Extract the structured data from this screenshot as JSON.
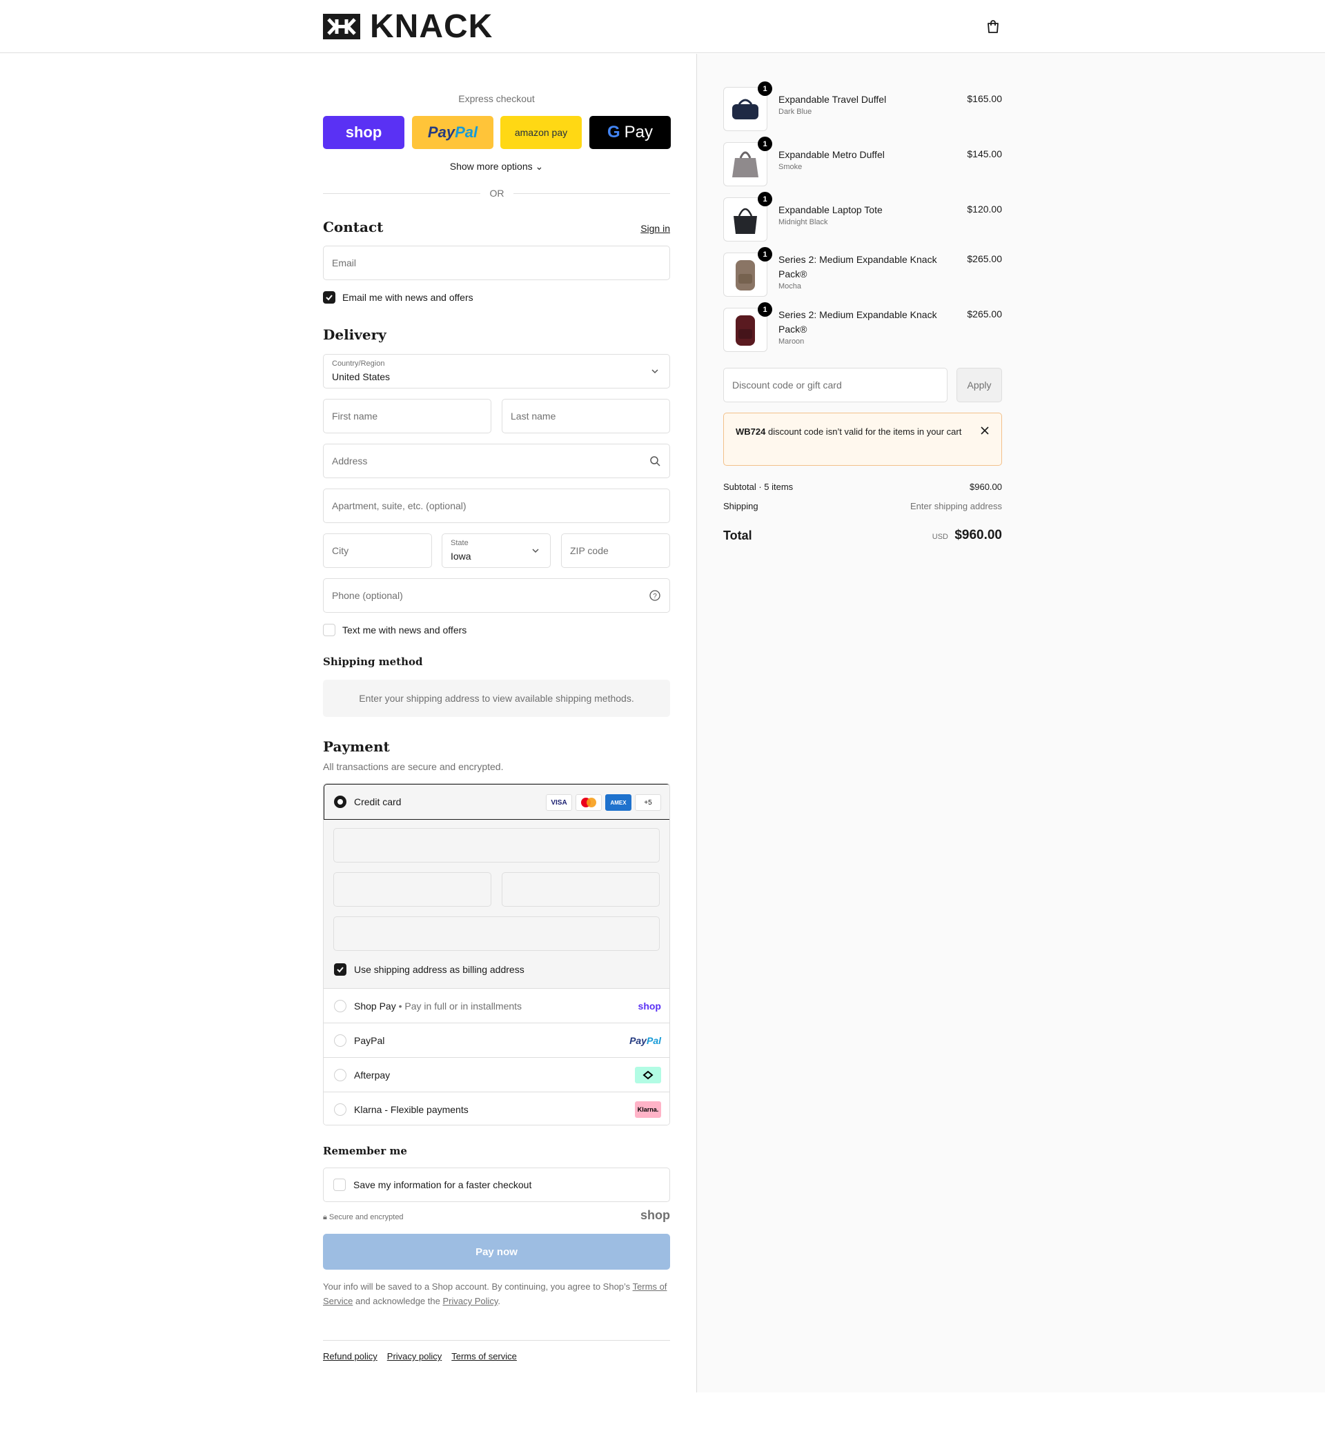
{
  "brand": {
    "name": "KNACK"
  },
  "express": {
    "title": "Express checkout",
    "shop_label": "shop",
    "paypal_label_1": "Pay",
    "paypal_label_2": "Pal",
    "amazon_label": "amazon pay",
    "gpay_label": "Pay",
    "show_more": "Show more options",
    "or": "OR"
  },
  "contact": {
    "heading": "Contact",
    "sign_in": "Sign in",
    "email_placeholder": "Email",
    "news_label": "Email me with news and offers"
  },
  "delivery": {
    "heading": "Delivery",
    "country_label": "Country/Region",
    "country_value": "United States",
    "first_name": "First name",
    "last_name": "Last name",
    "address": "Address",
    "apartment": "Apartment, suite, etc. (optional)",
    "city": "City",
    "state_label": "State",
    "state_value": "Iowa",
    "zip": "ZIP code",
    "phone": "Phone (optional)",
    "text_label": "Text me with news and offers"
  },
  "shipping": {
    "heading": "Shipping method",
    "message": "Enter your shipping address to view available shipping methods."
  },
  "payment": {
    "heading": "Payment",
    "subtitle": "All transactions are secure and encrypted.",
    "credit_card": "Credit card",
    "card_visa": "VISA",
    "card_more": "+5",
    "billing_label": "Use shipping address as billing address",
    "shop_pay": "Shop Pay",
    "shop_pay_sub": "Pay in full or in installments",
    "shop_pay_logo": "shop",
    "paypal": "PayPal",
    "afterpay": "Afterpay",
    "klarna": "Klarna - Flexible payments",
    "klarna_logo": "Klarna."
  },
  "remember": {
    "heading": "Remember me",
    "save_label": "Save my information for a faster checkout",
    "secure": "Secure and encrypted",
    "shop_logo": "shop"
  },
  "pay_now": "Pay now",
  "legal": {
    "text_1": "Your info will be saved to a Shop account. By continuing, you agree to Shop’s ",
    "terms": "Terms of Service",
    "text_2": " and acknowledge the ",
    "privacy": "Privacy Policy",
    "text_3": "."
  },
  "footer": {
    "refund": "Refund policy",
    "privacy": "Privacy policy",
    "terms": "Terms of service"
  },
  "cart": {
    "items": [
      {
        "name": "Expandable Travel Duffel",
        "variant": "Dark Blue",
        "price": "$165.00",
        "qty": "1",
        "color": "#1f2a44"
      },
      {
        "name": "Expandable Metro Duffel",
        "variant": "Smoke",
        "price": "$145.00",
        "qty": "1",
        "color": "#8f8a8c"
      },
      {
        "name": "Expandable Laptop Tote",
        "variant": "Midnight Black",
        "price": "$120.00",
        "qty": "1",
        "color": "#24262b"
      },
      {
        "name": "Series 2: Medium Expandable Knack Pack®",
        "variant": "Mocha",
        "price": "$265.00",
        "qty": "1",
        "color": "#8a7565"
      },
      {
        "name": "Series 2: Medium Expandable Knack Pack®",
        "variant": "Maroon",
        "price": "$265.00",
        "qty": "1",
        "color": "#5a1a20"
      }
    ],
    "discount_placeholder": "Discount code or gift card",
    "apply": "Apply",
    "alert_code": "WB724",
    "alert_text": " discount code isn’t valid for the items in your cart",
    "subtotal_label": "Subtotal · 5 items",
    "subtotal_value": "$960.00",
    "shipping_label": "Shipping",
    "shipping_value": "Enter shipping address",
    "total_label": "Total",
    "currency": "USD",
    "total_value": "$960.00"
  }
}
